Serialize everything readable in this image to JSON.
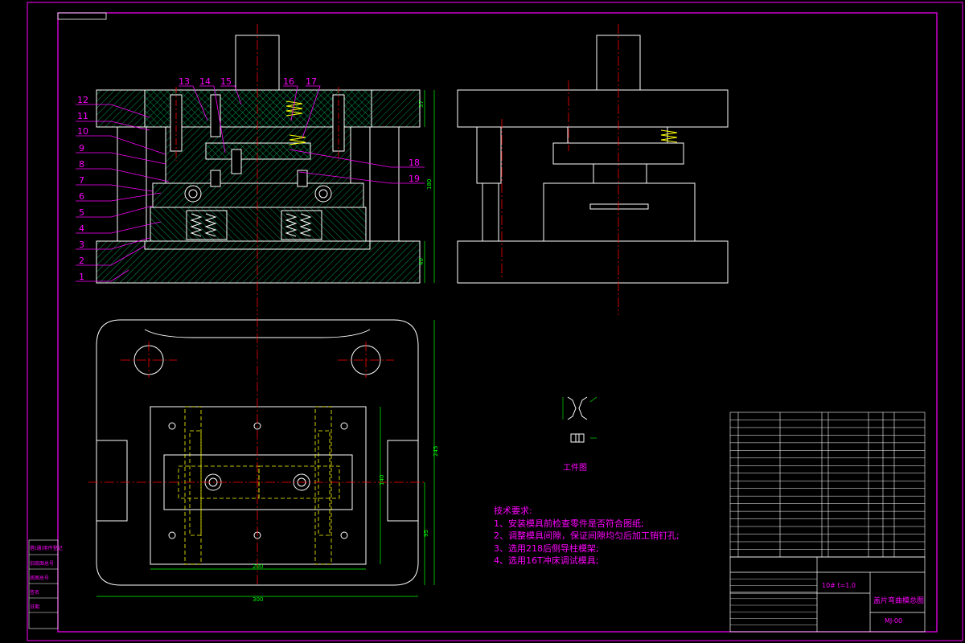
{
  "drawing": {
    "border_color": "#ff00ff",
    "line_color": "#ffffff",
    "center_color": "#ff0000",
    "hidden_color": "#ffff00",
    "hatch_color": "#00ff66",
    "leader_color": "#ff00ff",
    "dim_color": "#00ff00"
  },
  "balloons": {
    "left": [
      "12",
      "11",
      "10",
      "9",
      "8",
      "7",
      "6",
      "5",
      "4",
      "3",
      "2",
      "1"
    ],
    "top": [
      "13",
      "14",
      "15",
      "16",
      "17"
    ],
    "right": [
      "18",
      "19"
    ]
  },
  "dimensions": {
    "front_height_top": "37",
    "front_height_total": "180",
    "front_height_bottom": "40",
    "plan_width_inner": "200",
    "plan_width_outer": "300",
    "plan_height_outer": "245",
    "plan_height_inner": "140",
    "plan_height_small": "95"
  },
  "part_drawing": {
    "caption": "工件图"
  },
  "tech_requirements": {
    "heading": "技术要求:",
    "items": [
      "1、安装模具前检查零件是否符合图纸;",
      "2、调整模具间隙，保证间隙均匀后加工销钉孔;",
      "3、选用218后侧导柱模架;",
      "4、选用16T冲床调试模具;"
    ]
  },
  "title_block": {
    "drawing_name": "盖片弯曲模总图",
    "drawing_code": "MJ-00",
    "material_spec": "10# t=1.0"
  },
  "left_stamp": {
    "rows": [
      "借(通)用件登记",
      "旧底图总号",
      "底图总号",
      "签名",
      "日期"
    ]
  }
}
